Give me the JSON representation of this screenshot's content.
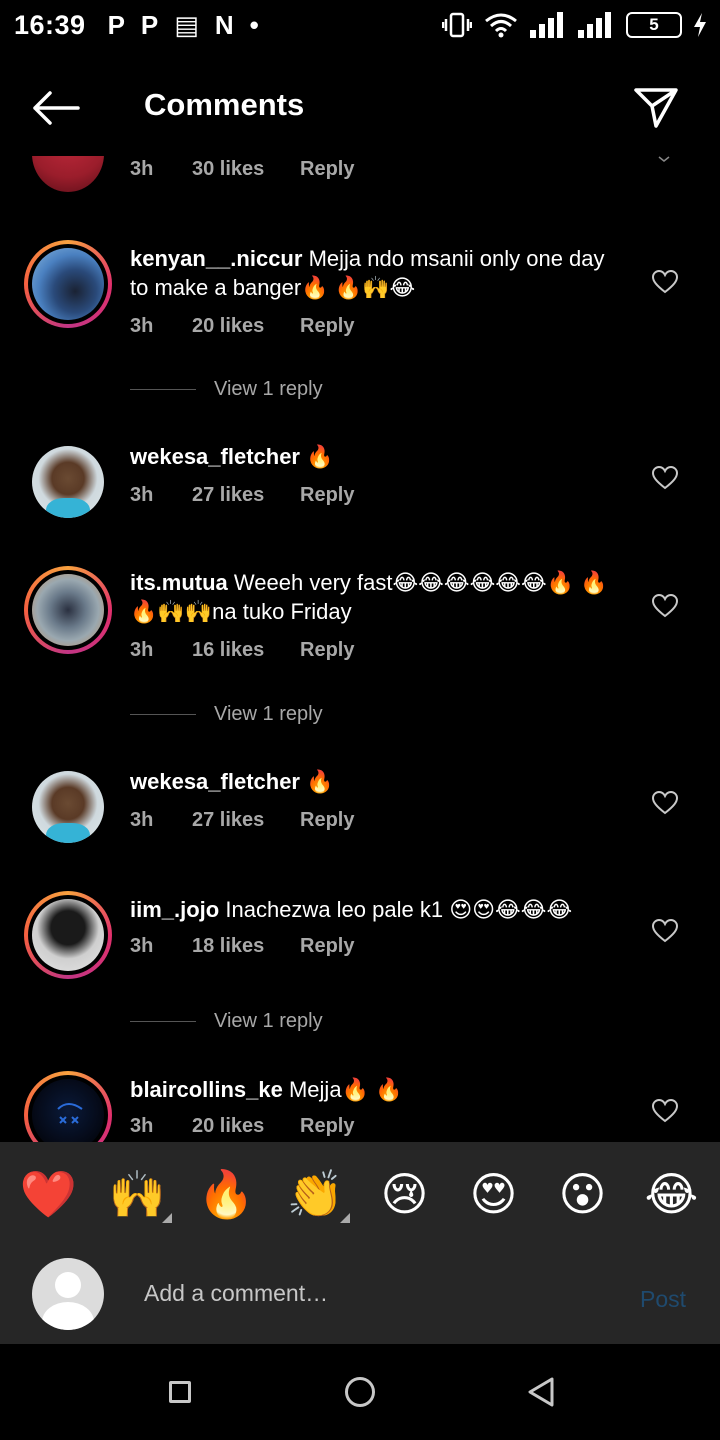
{
  "status_bar": {
    "time": "16:39",
    "notifications": [
      "P",
      "P",
      "▤",
      "N",
      "•"
    ],
    "battery": "5"
  },
  "header": {
    "title": "Comments",
    "back_icon": "arrow-left-icon",
    "share_icon": "paper-plane-icon"
  },
  "top_partial": {
    "time": "3h",
    "likes": "30 likes",
    "reply": "Reply"
  },
  "comments": [
    {
      "username": "kenyan__.niccur",
      "text": "Mejja ndo msanii only one day to make a banger🔥 🔥🙌😂",
      "time": "3h",
      "likes": "20 likes",
      "reply": "Reply",
      "view_replies": "View 1 reply"
    },
    {
      "username": "wekesa_fletcher",
      "text": "🔥",
      "time": "3h",
      "likes": "27 likes",
      "reply": "Reply"
    },
    {
      "username": "its.mutua",
      "text": "Weeeh very fast😂😂😂😂😂😂🔥 🔥 🔥🙌🙌na tuko Friday",
      "time": "3h",
      "likes": "16 likes",
      "reply": "Reply",
      "view_replies": "View 1 reply"
    },
    {
      "username": "wekesa_fletcher",
      "text": "🔥",
      "time": "3h",
      "likes": "27 likes",
      "reply": "Reply"
    },
    {
      "username": "iim_.jojo",
      "text": "Inachezwa leo pale k1 😍😍😂😂😂",
      "time": "3h",
      "likes": "18 likes",
      "reply": "Reply",
      "view_replies": "View 1 reply"
    },
    {
      "username": "blaircollins_ke",
      "text": "Mejja🔥 🔥",
      "time": "3h",
      "likes": "20 likes",
      "reply": "Reply"
    }
  ],
  "emoji_bar": [
    "❤️",
    "🙌",
    "🔥",
    "👏",
    "😢",
    "😍",
    "😮",
    "😂"
  ],
  "input": {
    "placeholder": "Add a comment…",
    "post_label": "Post"
  },
  "colors": {
    "background": "#000000",
    "secondary_text": "#a8a8a8",
    "panel": "#262626",
    "post_disabled": "#1f4a6e"
  }
}
